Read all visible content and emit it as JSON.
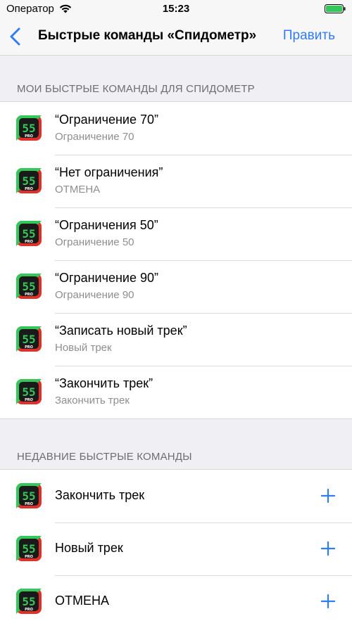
{
  "status_bar": {
    "carrier": "Оператор",
    "time": "15:23"
  },
  "nav": {
    "title": "Быстрые команды «Спидометр»",
    "edit_label": "Править"
  },
  "my_shortcuts": {
    "header": "МОИ БЫСТРЫЕ КОМАНДЫ ДЛЯ СПИДОМЕТР",
    "items": [
      {
        "title": "“Ограничение 70”",
        "subtitle": "Ограничение 70"
      },
      {
        "title": "“Нет ограничения”",
        "subtitle": "ОТМЕНА"
      },
      {
        "title": "“Ограничения 50”",
        "subtitle": "Ограничение 50"
      },
      {
        "title": "“Ограничение 90”",
        "subtitle": "Ограничение 90"
      },
      {
        "title": "“Записать новый трек”",
        "subtitle": "Новый трек"
      },
      {
        "title": "“Закончить трек”",
        "subtitle": "Закончить трек"
      }
    ]
  },
  "recent_shortcuts": {
    "header": "НЕДАВНИЕ БЫСТРЫЕ КОМАНДЫ",
    "items": [
      {
        "title": "Закончить трек"
      },
      {
        "title": "Новый трек"
      },
      {
        "title": "ОТМЕНА"
      }
    ]
  },
  "app_icon": {
    "text": "55",
    "badge": "PRO"
  },
  "colors": {
    "accent": "#2f7cf6",
    "icon_green": "#34c759",
    "icon_red": "#e0302a",
    "icon_bg": "#1a1a1a"
  }
}
